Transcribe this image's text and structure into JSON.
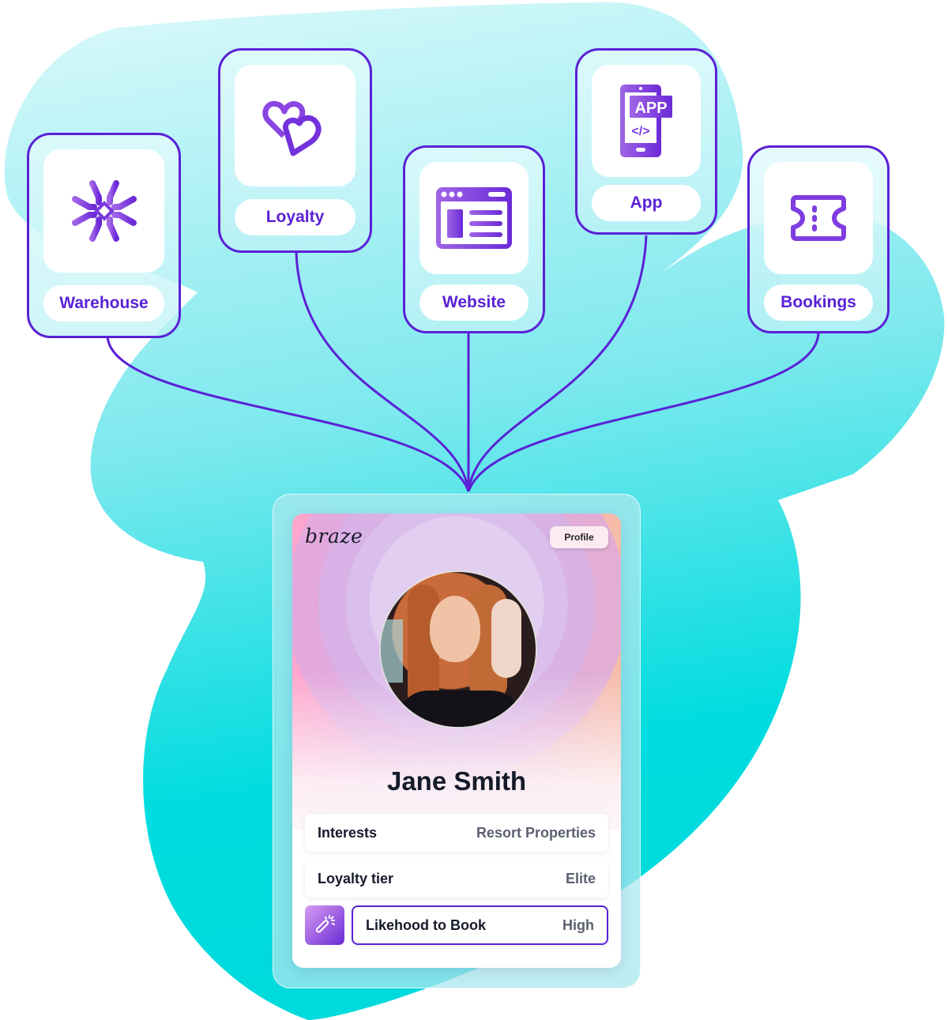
{
  "colors": {
    "accent": "#5a21d6",
    "blob_light": "#d8f8fa",
    "blob_dark": "#00dcdf",
    "text_dark": "#151a2a",
    "text_muted": "#5b6070"
  },
  "sources": [
    {
      "id": "warehouse",
      "label": "Warehouse",
      "icon": "snowflake-icon"
    },
    {
      "id": "loyalty",
      "label": "Loyalty",
      "icon": "two-hearts-icon"
    },
    {
      "id": "website",
      "label": "Website",
      "icon": "browser-window-icon"
    },
    {
      "id": "app",
      "label": "App",
      "icon": "mobile-app-icon",
      "icon_text": "APP",
      "icon_code": "</>"
    },
    {
      "id": "bookings",
      "label": "Bookings",
      "icon": "ticket-icon"
    }
  ],
  "profile": {
    "brand": "braze",
    "button_label": "Profile",
    "name": "Jane Smith",
    "avatar": "profile-photo",
    "attributes": [
      {
        "key": "Interests",
        "value": "Resort Properties"
      },
      {
        "key": "Loyalty tier",
        "value": "Elite"
      },
      {
        "key": "Likehood to Book",
        "value": "High",
        "icon": "magic-wand-icon"
      }
    ]
  }
}
